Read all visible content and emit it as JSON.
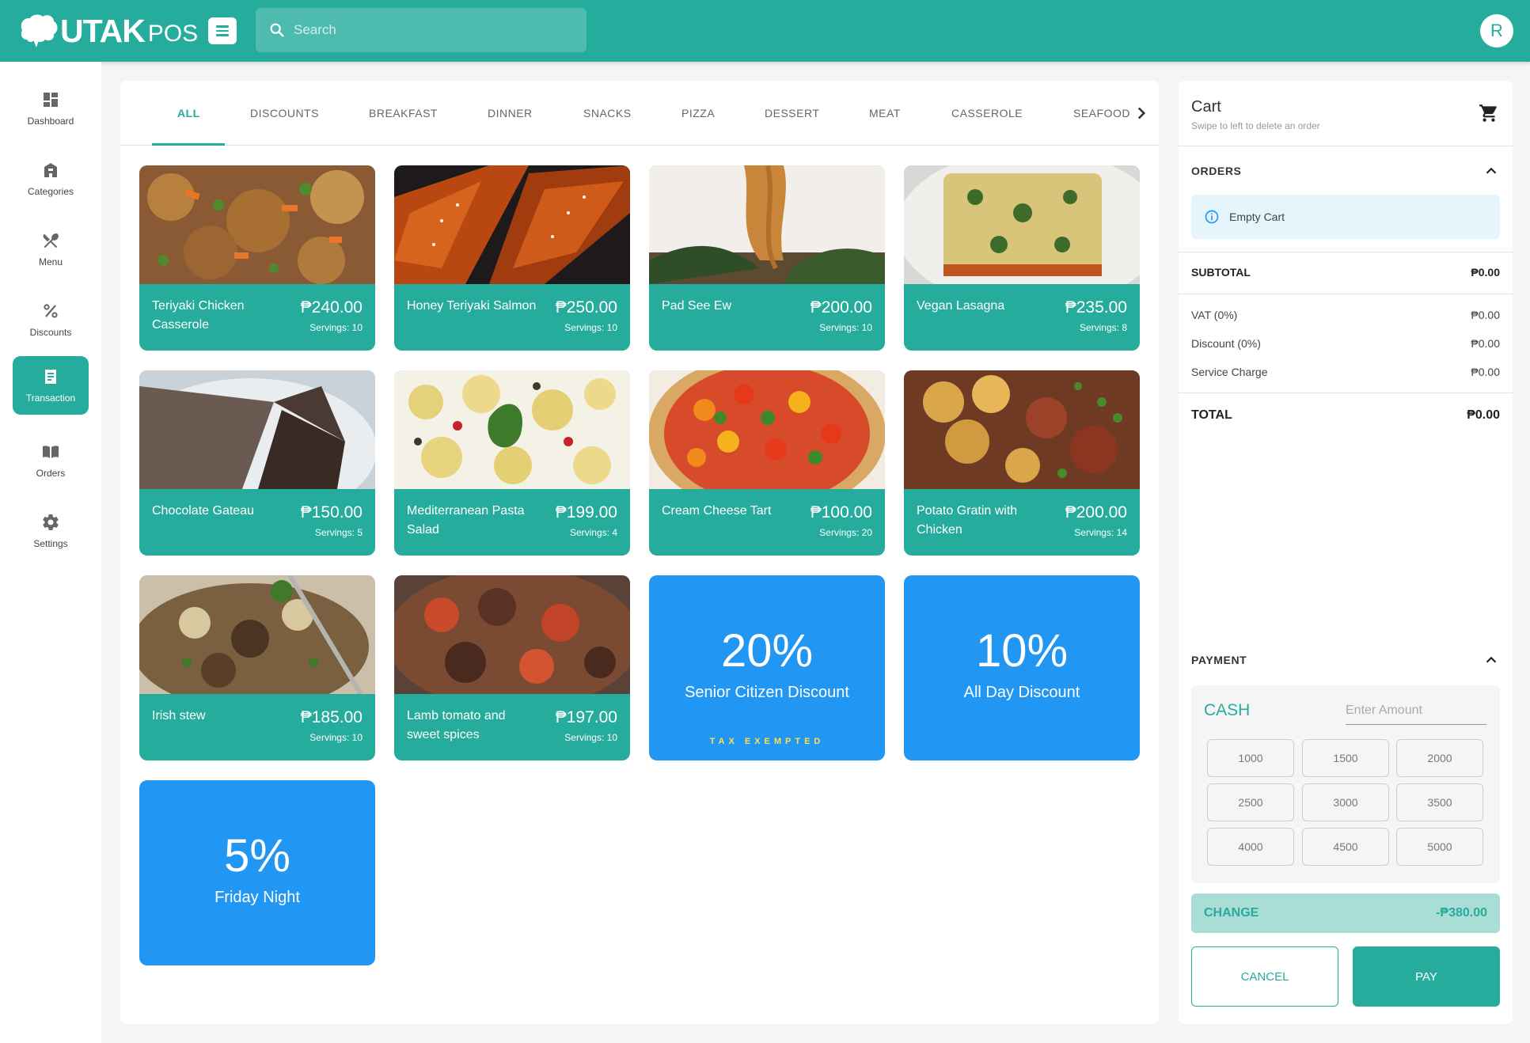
{
  "brand": {
    "name": "UTAK",
    "suffix": "POS"
  },
  "search": {
    "placeholder": "Search"
  },
  "user": {
    "initial": "R"
  },
  "sidebar": {
    "items": [
      {
        "label": "Dashboard",
        "icon": "dashboard-icon"
      },
      {
        "label": "Categories",
        "icon": "store-icon"
      },
      {
        "label": "Menu",
        "icon": "utensils-icon"
      },
      {
        "label": "Discounts",
        "icon": "percent-icon"
      },
      {
        "label": "Transaction",
        "icon": "receipt-icon",
        "active": true
      },
      {
        "label": "Orders",
        "icon": "book-icon"
      },
      {
        "label": "Settings",
        "icon": "gear-icon"
      }
    ]
  },
  "tabs": [
    {
      "label": "ALL",
      "active": true
    },
    {
      "label": "DISCOUNTS"
    },
    {
      "label": "BREAKFAST"
    },
    {
      "label": "DINNER"
    },
    {
      "label": "SNACKS"
    },
    {
      "label": "PIZZA"
    },
    {
      "label": "DESSERT"
    },
    {
      "label": "MEAT"
    },
    {
      "label": "CASSEROLE"
    },
    {
      "label": "SEAFOOD"
    }
  ],
  "products": [
    {
      "name": "Teriyaki Chicken Casserole",
      "price": "₱240.00",
      "servings": "Servings: 10",
      "image": "fried-rice-photo"
    },
    {
      "name": "Honey Teriyaki Salmon",
      "price": "₱250.00",
      "servings": "Servings: 10",
      "image": "salmon-photo"
    },
    {
      "name": "Pad See Ew",
      "price": "₱200.00",
      "servings": "Servings: 10",
      "image": "noodles-photo"
    },
    {
      "name": "Vegan Lasagna",
      "price": "₱235.00",
      "servings": "Servings: 8",
      "image": "lasagna-photo"
    },
    {
      "name": "Chocolate Gateau",
      "price": "₱150.00",
      "servings": "Servings: 5",
      "image": "cake-photo"
    },
    {
      "name": "Mediterranean Pasta Salad",
      "price": "₱199.00",
      "servings": "Servings: 4",
      "image": "pasta-salad-photo"
    },
    {
      "name": "Cream Cheese Tart",
      "price": "₱100.00",
      "servings": "Servings: 20",
      "image": "tart-photo"
    },
    {
      "name": "Potato Gratin with Chicken",
      "price": "₱200.00",
      "servings": "Servings: 14",
      "image": "gratin-photo"
    },
    {
      "name": "Irish stew",
      "price": "₱185.00",
      "servings": "Servings: 10",
      "image": "stew-photo"
    },
    {
      "name": "Lamb tomato and sweet spices",
      "price": "₱197.00",
      "servings": "Servings: 10",
      "image": "lamb-photo"
    }
  ],
  "discounts": [
    {
      "percent": "20%",
      "name": "Senior Citizen Discount",
      "note": "TAX EXEMPTED"
    },
    {
      "percent": "10%",
      "name": "All Day Discount",
      "note": ""
    },
    {
      "percent": "5%",
      "name": "Friday Night",
      "note": ""
    }
  ],
  "cart": {
    "title": "Cart",
    "subtitle": "Swipe to left to delete an order",
    "orders_header": "ORDERS",
    "empty": "Empty Cart",
    "subtotal": {
      "label": "SUBTOTAL",
      "value": "₱0.00"
    },
    "vat": {
      "label": "VAT (0%)",
      "value": "₱0.00"
    },
    "discount": {
      "label": "Discount (0%)",
      "value": "₱0.00"
    },
    "service": {
      "label": "Service Charge",
      "value": "₱0.00"
    },
    "total": {
      "label": "TOTAL",
      "value": "₱0.00"
    },
    "payment_header": "PAYMENT",
    "cash_label": "CASH",
    "amount_placeholder": "Enter Amount",
    "quick_amounts": [
      "1000",
      "1500",
      "2000",
      "2500",
      "3000",
      "3500",
      "4000",
      "4500",
      "5000"
    ],
    "change": {
      "label": "CHANGE",
      "value": "-₱380.00"
    },
    "cancel_label": "CANCEL",
    "pay_label": "PAY"
  },
  "colors": {
    "primary": "#26ac9c",
    "discount": "#2196f3",
    "accent_yellow": "#ffe14d"
  }
}
